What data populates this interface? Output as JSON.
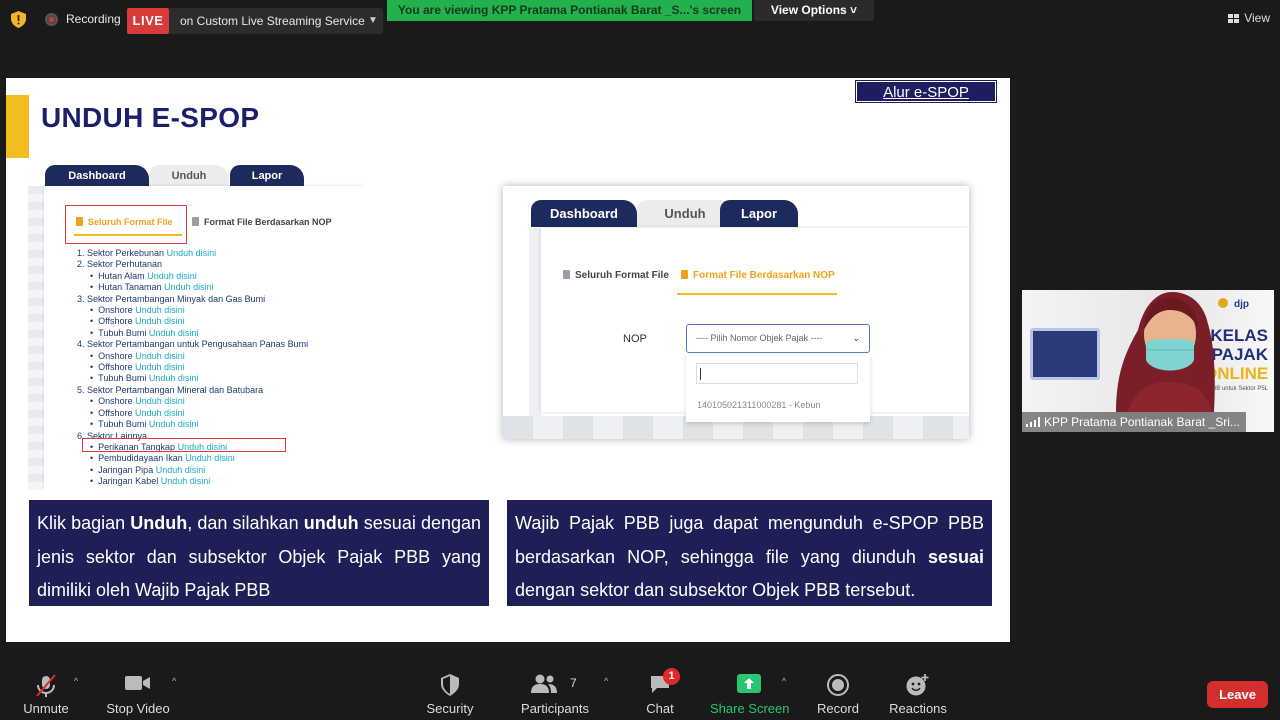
{
  "top_bar": {
    "recording_label": "Recording",
    "live_badge": "LIVE",
    "live_service": "on Custom Live Streaming Service",
    "viewing_banner": "You are viewing KPP Pratama Pontianak Barat _S...'s screen",
    "view_options": "View Options ˅",
    "view_button": "View"
  },
  "slide": {
    "title": "UNDUH E-SPOP",
    "flow_tag": "Alur e-SPOP",
    "left_screenshot": {
      "tabs": [
        "Dashboard",
        "Unduh",
        "Lapor"
      ],
      "subtab_active": "Seluruh Format File",
      "subtab_other": "Format File Berdasarkan NOP",
      "download_text": "Unduh disini",
      "sectors": [
        {
          "title": "1. Sektor Perkebunan",
          "inline_link": true,
          "subs": []
        },
        {
          "title": "2. Sektor Perhutanan",
          "inline_link": false,
          "subs": [
            "Hutan Alam",
            "Hutan Tanaman"
          ]
        },
        {
          "title": "3. Sektor Pertambangan Minyak dan Gas Bumi",
          "inline_link": false,
          "subs": [
            "Onshore",
            "Offshore",
            "Tubuh Bumi"
          ]
        },
        {
          "title": "4. Sektor Pertambangan untuk Pengusahaan Panas Bumi",
          "inline_link": false,
          "subs": [
            "Onshore",
            "Offshore",
            "Tubuh Bumi"
          ]
        },
        {
          "title": "5. Sektor Pertambangan Mineral dan Batubara",
          "inline_link": false,
          "subs": [
            "Onshore",
            "Offshore",
            "Tubuh Bumi"
          ]
        },
        {
          "title": "6. Sektor Lainnya",
          "inline_link": false,
          "subs": [
            "Perikanan Tangkap",
            "Pembudidayaan Ikan",
            "Jaringan Pipa",
            "Jaringan Kabel"
          ]
        }
      ]
    },
    "right_screenshot": {
      "tabs": [
        "Dashboard",
        "Unduh",
        "Lapor"
      ],
      "subtab_other": "Seluruh Format File",
      "subtab_active": "Format File Berdasarkan NOP",
      "nop_label": "NOP",
      "nop_placeholder": "---- Pilih Nomor Objek Pajak ----",
      "nop_option": "140105021311000281 - Kebun"
    },
    "caption_left": {
      "p1": "Klik bagian ",
      "b1": "Unduh",
      "p2": ", dan silahkan ",
      "b2": "unduh",
      "p3": " sesuai dengan jenis sektor dan subsektor Objek Pajak PBB yang dimiliki oleh Wajib Pajak PBB"
    },
    "caption_right": {
      "p1": "Wajib Pajak PBB juga dapat mengunduh e-SPOP PBB berdasarkan NOP, sehingga file yang diunduh ",
      "b1": "sesuai",
      "p2": " dengan sektor dan subsektor Objek PBB tersebut."
    }
  },
  "participant": {
    "name": "KPP Pratama Pontianak Barat _Sri...",
    "logo_text": "djp",
    "banner_lines": [
      "KELAS",
      "PAJAK",
      "ONLINE"
    ],
    "banner_footer": "PBB untuk Sektor P5L"
  },
  "bottom_bar": {
    "unmute": "Unmute",
    "stop_video": "Stop Video",
    "security": "Security",
    "participants": "Participants",
    "participants_count": "7",
    "chat": "Chat",
    "chat_badge": "1",
    "share_screen": "Share Screen",
    "record": "Record",
    "reactions": "Reactions",
    "leave": "Leave"
  },
  "colors": {
    "live_red": "#d93b3b",
    "banner_green": "#23b14d",
    "slide_navy": "#1e1f57",
    "accent_yellow": "#f2bd21",
    "share_green": "#28c76f",
    "leave_red": "#d32f2f"
  }
}
